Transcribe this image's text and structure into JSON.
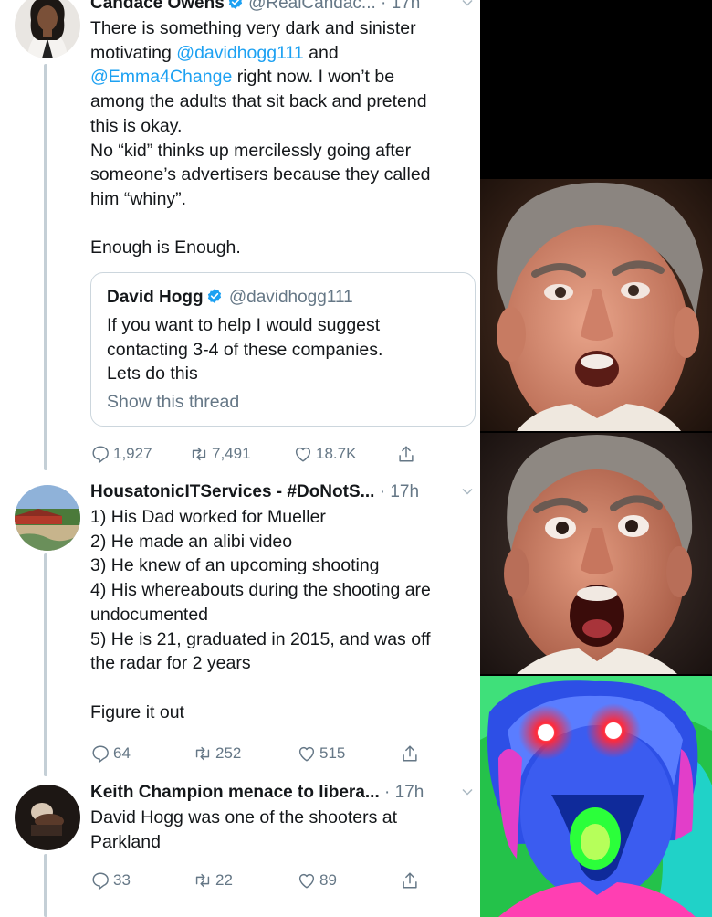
{
  "tweets": [
    {
      "name": "Candace Owens",
      "handle": "@RealCandac...",
      "time": "· 17h",
      "paragraphs": [
        [
          "There is something very dark and sinister",
          "motivating "
        ],
        [
          "among the adults that sit back and pretend",
          "this is okay.",
          "No “kid” thinks up mercilessly going after",
          "someone’s advertisers because they called",
          "him “whiny”."
        ],
        [
          "Enough is Enough."
        ]
      ],
      "mention1": "@davidhogg111",
      "mid_text": " and",
      "mention2": "@Emma4Change",
      "after_mention2": " right now. I won’t be",
      "quote": {
        "name": "David Hogg",
        "handle": "@davidhogg111",
        "lines": [
          "If you want to help I would suggest",
          "contacting 3-4 of these companies.",
          "Lets do this"
        ],
        "link": "Show this thread"
      },
      "replies": "1,927",
      "retweets": "7,491",
      "likes": "18.7K"
    },
    {
      "name": "HousatonicITServices - #DoNotS...",
      "time": "· 17h",
      "lines": [
        "1) His Dad worked for Mueller",
        "2) He made an alibi video",
        "3) He knew of an upcoming shooting",
        "4) His whereabouts during the shooting are",
        "undocumented",
        "5) He is 21, graduated in 2015, and was off",
        "the radar for 2 years"
      ],
      "closing": "Figure it out",
      "replies": "64",
      "retweets": "252",
      "likes": "515"
    },
    {
      "name": "Keith Champion menace to libera...",
      "time": "· 17h",
      "lines": [
        "David Hogg was one of the shooters at",
        "Parkland"
      ],
      "replies": "33",
      "retweets": "22",
      "likes": "89"
    }
  ],
  "colors": {
    "link": "#1da1f2",
    "secondary_text": "#657786",
    "verified": "#1da1f2",
    "thread_line": "#c4cfd6"
  },
  "icons": [
    "verified-badge-icon",
    "chevron-down-icon",
    "reply-icon",
    "retweet-icon",
    "like-icon",
    "share-icon"
  ],
  "meme_panels": [
    "surprised-face-panel",
    "shocked-face-panel",
    "deep-fried-face-panel"
  ]
}
